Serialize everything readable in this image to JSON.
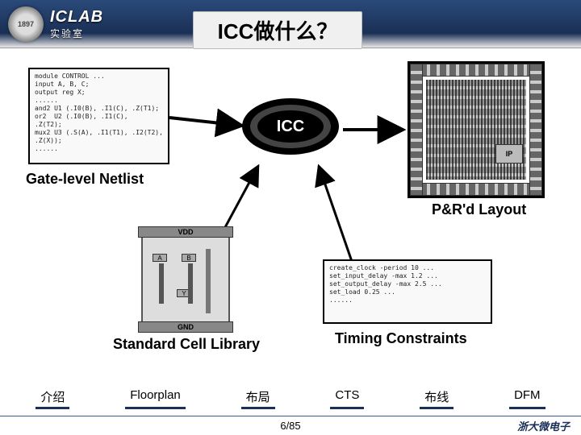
{
  "header": {
    "lab_name": "ICLAB",
    "lab_sub": "实验室",
    "seal_text": "1897",
    "title": "ICC做什么？"
  },
  "diagram": {
    "center_label": "ICC",
    "netlist": {
      "label": "Gate-level Netlist",
      "code": "module CONTROL ...\ninput A, B, C;\noutput reg X;\n......\nand2 U1 (.I0(B), .I1(C), .Z(T1);\nor2  U2 (.I0(B), .I1(C),\n.Z(T2);\nmux2 U3 (.S(A), .I1(T1), .I2(T2),\n.Z(X));\n......"
    },
    "stdcell": {
      "label": "Standard Cell Library",
      "vdd": "VDD",
      "gnd": "GND",
      "pins": [
        "A",
        "B",
        "Y"
      ]
    },
    "timing": {
      "label": "Timing Constraints",
      "code": "create_clock -period 10 ...\nset_input_delay -max 1.2 ...\nset_output_delay -max 2.5 ...\nset_load 0.25 ...\n......"
    },
    "layout": {
      "label": "P&R'd Layout",
      "ip_label": "IP"
    }
  },
  "tabs": [
    "介绍",
    "Floorplan",
    "布局",
    "CTS",
    "布线",
    "DFM"
  ],
  "footer": {
    "page": "6/85",
    "brand": "浙大微电子"
  }
}
